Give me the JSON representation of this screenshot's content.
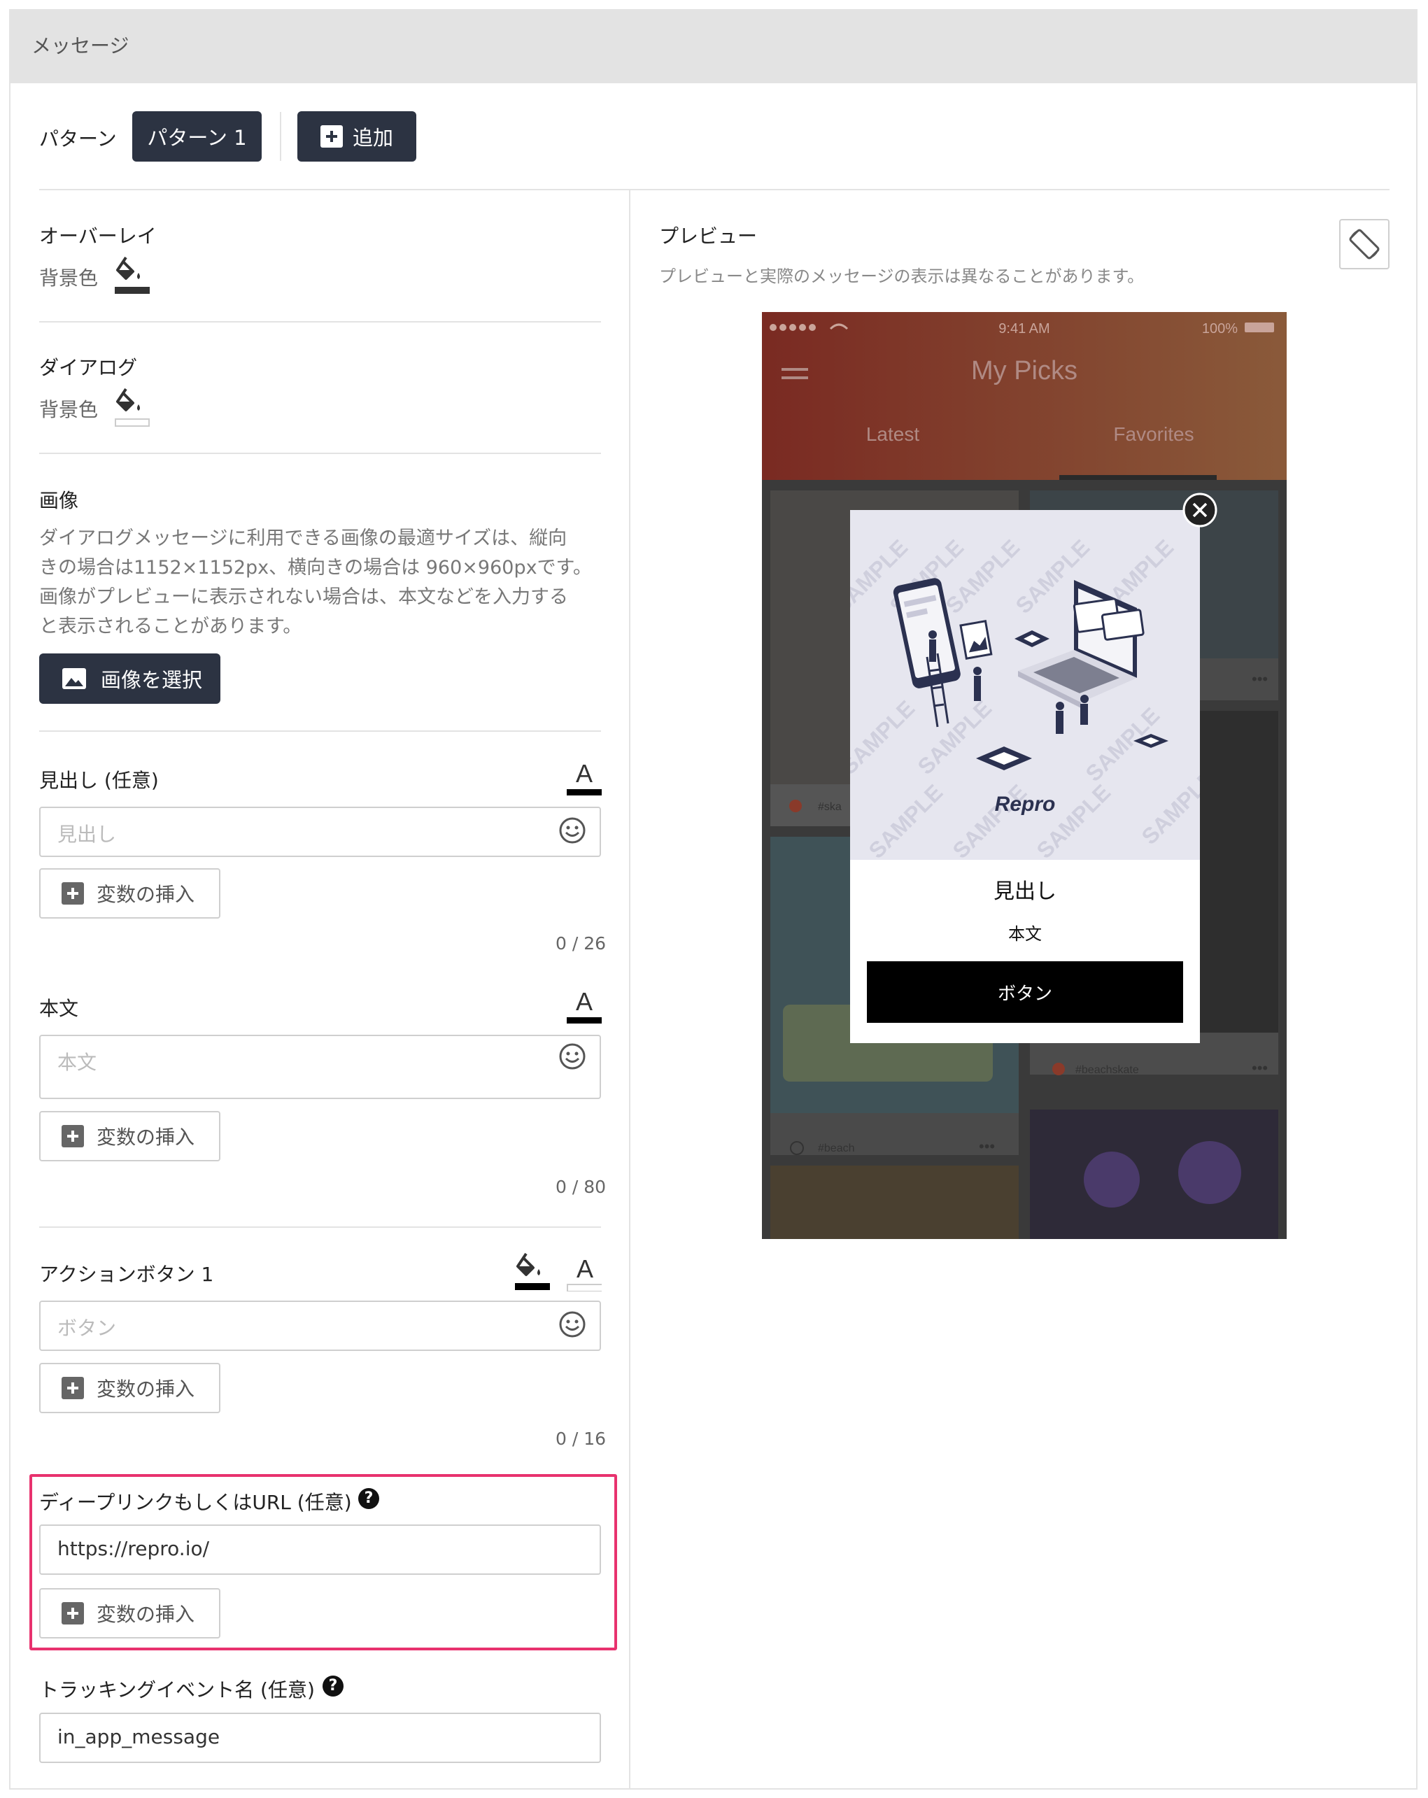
{
  "header": {
    "title": "メッセージ"
  },
  "pattern": {
    "label": "パターン",
    "active_tab": "パターン 1",
    "add_label": "追加"
  },
  "overlay": {
    "title": "オーバーレイ",
    "bg_label": "背景色"
  },
  "dialog": {
    "title": "ダイアログ",
    "bg_label": "背景色"
  },
  "image": {
    "title": "画像",
    "description_lines": [
      "ダイアログメッセージに利用できる画像の最適サイズは、縦向",
      "きの場合は1152×1152px、横向きの場合は 960×960pxです。",
      "画像がプレビューに表示されない場合は、本文などを入力する",
      "と表示されることがあります。"
    ],
    "select_label": "画像を選択"
  },
  "heading": {
    "title": "見出し (任意)",
    "placeholder": "見出し",
    "insert_var_label": "変数の挿入",
    "counter": "0 / 26",
    "text_color": "#000000"
  },
  "body_text": {
    "title": "本文",
    "placeholder": "本文",
    "insert_var_label": "変数の挿入",
    "counter": "0 / 80",
    "text_color": "#000000"
  },
  "action_button": {
    "title": "アクションボタン 1",
    "placeholder": "ボタン",
    "insert_var_label": "変数の挿入",
    "counter": "0 / 16",
    "bg_color": "#000000",
    "text_color": "#ffffff"
  },
  "deeplink": {
    "title": "ディープリンクもしくはURL (任意)",
    "value": "https://repro.io/",
    "insert_var_label": "変数の挿入"
  },
  "tracking": {
    "title": "トラッキングイベント名 (任意)",
    "value": "in_app_message"
  },
  "preview": {
    "title": "プレビュー",
    "note": "プレビューと実際のメッセージの表示は異なることがあります。",
    "phone": {
      "time": "9:41 AM",
      "battery": "100%",
      "app_title": "My Picks",
      "tabs": [
        "Latest",
        "Favorites"
      ],
      "card_tags": [
        "#ska",
        "#beachskate",
        "#beach"
      ]
    },
    "dialog": {
      "watermark": "SAMPLE",
      "logo": "Repro",
      "heading": "見出し",
      "body": "本文",
      "button": "ボタン"
    }
  },
  "colors": {
    "dark_button": "#2c3342",
    "highlight_border": "#e8326e",
    "header_bg": "#e3e3e3"
  }
}
